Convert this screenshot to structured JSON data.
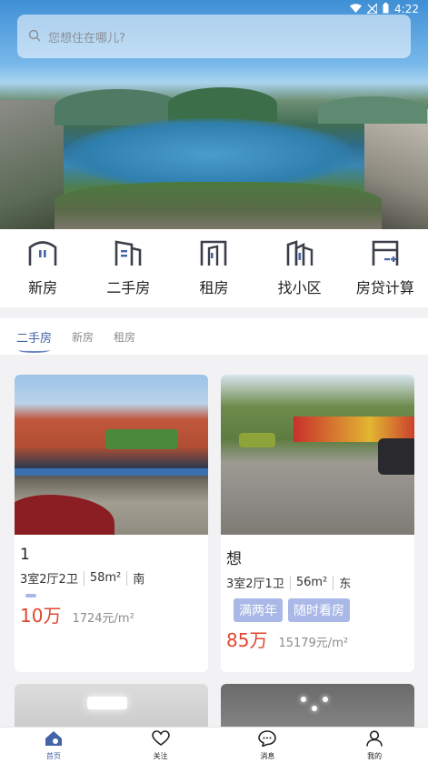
{
  "status_bar": {
    "time": "4:22",
    "icons": [
      "wifi-icon",
      "signal-icon",
      "battery-icon"
    ]
  },
  "search": {
    "placeholder": "您想住在哪儿?"
  },
  "categories": [
    {
      "label": "新房",
      "icon": "new-house-icon"
    },
    {
      "label": "二手房",
      "icon": "second-hand-house-icon"
    },
    {
      "label": "租房",
      "icon": "rent-house-icon"
    },
    {
      "label": "找小区",
      "icon": "community-icon"
    },
    {
      "label": "房贷计算",
      "icon": "mortgage-calculator-icon"
    }
  ],
  "tabs": [
    {
      "label": "二手房",
      "active": true
    },
    {
      "label": "新房",
      "active": false
    },
    {
      "label": "租房",
      "active": false
    }
  ],
  "listings": [
    {
      "title": "1",
      "layout": "3室2厅2卫",
      "area": "58m²",
      "orientation": "南",
      "tags": [],
      "price": "10万",
      "unit_price": "1724元/m²"
    },
    {
      "title": "想",
      "layout": "3室2厅1卫",
      "area": "56m²",
      "orientation": "东",
      "tags": [
        "满两年",
        "随时看房"
      ],
      "price": "85万",
      "unit_price": "15179元/m²"
    }
  ],
  "bottom_nav": [
    {
      "label": "首页",
      "icon": "home-icon",
      "active": true
    },
    {
      "label": "关注",
      "icon": "heart-icon",
      "active": false
    },
    {
      "label": "消息",
      "icon": "message-icon",
      "active": false
    },
    {
      "label": "我的",
      "icon": "user-icon",
      "active": false
    }
  ],
  "colors": {
    "accent": "#4463a8",
    "price": "#e1462f",
    "tag": "#a9b8e6"
  }
}
